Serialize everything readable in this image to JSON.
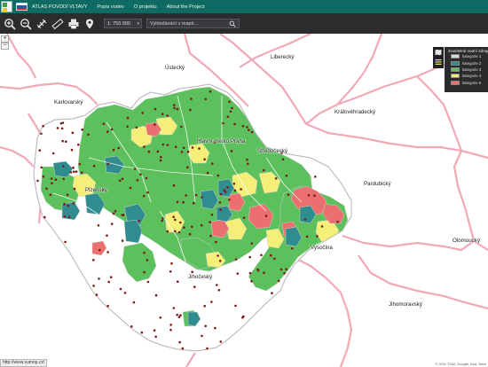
{
  "nav": {
    "links": [
      "ATLAS POVODÍ VLTAVY",
      "Popis vrstev",
      "O projektu",
      "About the Project"
    ]
  },
  "toolbar": {
    "tools": [
      "zoom-in-icon",
      "zoom-out-icon",
      "pan-icon",
      "measure-icon",
      "print-icon",
      "location-icon"
    ],
    "scale_value": "1: 750 000",
    "search_placeholder": "Vyhledávání v mapě..."
  },
  "map": {
    "region_labels": [
      "Ústecký",
      "Liberecký",
      "Karlovarský",
      "Královéhradecký",
      "Hlavní město Praha",
      "Středočeský",
      "Plzeňský",
      "Pardubický",
      "Vysočina",
      "Olomoucký",
      "Jihočeský",
      "Jihomoravský"
    ],
    "zoom_in_label": "+",
    "zoom_out_label": "−"
  },
  "legend": {
    "title": "Zranitelné vodní zdroje",
    "items": [
      {
        "label": "kategorie 1",
        "color": "#d9d9d9"
      },
      {
        "label": "kategorie 2",
        "color": "#2f8c8f"
      },
      {
        "label": "kategorie 3",
        "color": "#5cc15c"
      },
      {
        "label": "kategorie 4",
        "color": "#f4ef79"
      },
      {
        "label": "kategorie 5",
        "color": "#ec6f6f"
      }
    ]
  },
  "status": {
    "url": "http://www.vumop.cz/",
    "copyright": "© VÚV TGM, Google, Esri, Here"
  },
  "colors": {
    "nav_bg": "#0f6a63",
    "toolbar_bg": "#2b2c2e",
    "region_border": "#f2a9b6",
    "catchment_border": "#d8d8d8",
    "reservoir_point": "#7a1a1a"
  }
}
